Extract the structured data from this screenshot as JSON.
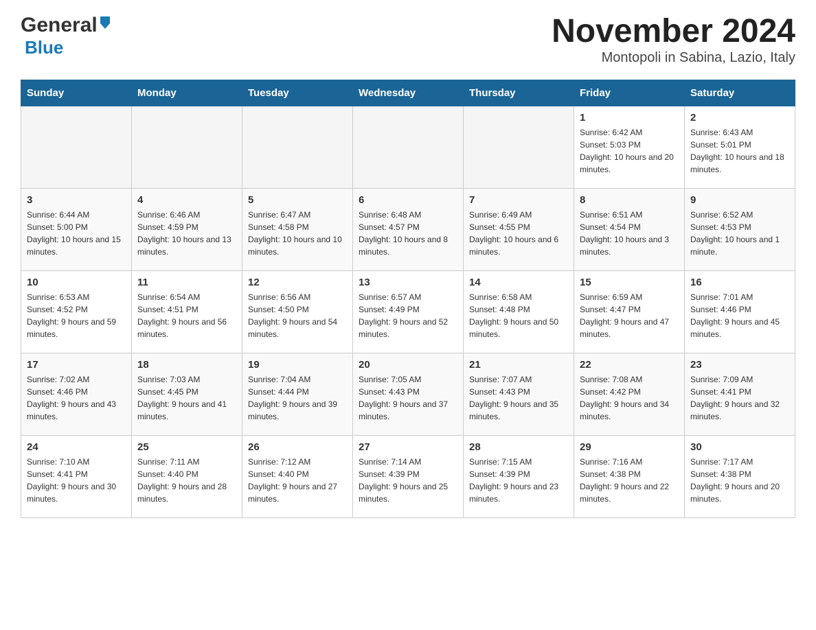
{
  "logo": {
    "general": "General",
    "blue": "Blue"
  },
  "title": "November 2024",
  "subtitle": "Montopoli in Sabina, Lazio, Italy",
  "weekdays": [
    "Sunday",
    "Monday",
    "Tuesday",
    "Wednesday",
    "Thursday",
    "Friday",
    "Saturday"
  ],
  "weeks": [
    [
      {
        "day": "",
        "sunrise": "",
        "sunset": "",
        "daylight": ""
      },
      {
        "day": "",
        "sunrise": "",
        "sunset": "",
        "daylight": ""
      },
      {
        "day": "",
        "sunrise": "",
        "sunset": "",
        "daylight": ""
      },
      {
        "day": "",
        "sunrise": "",
        "sunset": "",
        "daylight": ""
      },
      {
        "day": "",
        "sunrise": "",
        "sunset": "",
        "daylight": ""
      },
      {
        "day": "1",
        "sunrise": "Sunrise: 6:42 AM",
        "sunset": "Sunset: 5:03 PM",
        "daylight": "Daylight: 10 hours and 20 minutes."
      },
      {
        "day": "2",
        "sunrise": "Sunrise: 6:43 AM",
        "sunset": "Sunset: 5:01 PM",
        "daylight": "Daylight: 10 hours and 18 minutes."
      }
    ],
    [
      {
        "day": "3",
        "sunrise": "Sunrise: 6:44 AM",
        "sunset": "Sunset: 5:00 PM",
        "daylight": "Daylight: 10 hours and 15 minutes."
      },
      {
        "day": "4",
        "sunrise": "Sunrise: 6:46 AM",
        "sunset": "Sunset: 4:59 PM",
        "daylight": "Daylight: 10 hours and 13 minutes."
      },
      {
        "day": "5",
        "sunrise": "Sunrise: 6:47 AM",
        "sunset": "Sunset: 4:58 PM",
        "daylight": "Daylight: 10 hours and 10 minutes."
      },
      {
        "day": "6",
        "sunrise": "Sunrise: 6:48 AM",
        "sunset": "Sunset: 4:57 PM",
        "daylight": "Daylight: 10 hours and 8 minutes."
      },
      {
        "day": "7",
        "sunrise": "Sunrise: 6:49 AM",
        "sunset": "Sunset: 4:55 PM",
        "daylight": "Daylight: 10 hours and 6 minutes."
      },
      {
        "day": "8",
        "sunrise": "Sunrise: 6:51 AM",
        "sunset": "Sunset: 4:54 PM",
        "daylight": "Daylight: 10 hours and 3 minutes."
      },
      {
        "day": "9",
        "sunrise": "Sunrise: 6:52 AM",
        "sunset": "Sunset: 4:53 PM",
        "daylight": "Daylight: 10 hours and 1 minute."
      }
    ],
    [
      {
        "day": "10",
        "sunrise": "Sunrise: 6:53 AM",
        "sunset": "Sunset: 4:52 PM",
        "daylight": "Daylight: 9 hours and 59 minutes."
      },
      {
        "day": "11",
        "sunrise": "Sunrise: 6:54 AM",
        "sunset": "Sunset: 4:51 PM",
        "daylight": "Daylight: 9 hours and 56 minutes."
      },
      {
        "day": "12",
        "sunrise": "Sunrise: 6:56 AM",
        "sunset": "Sunset: 4:50 PM",
        "daylight": "Daylight: 9 hours and 54 minutes."
      },
      {
        "day": "13",
        "sunrise": "Sunrise: 6:57 AM",
        "sunset": "Sunset: 4:49 PM",
        "daylight": "Daylight: 9 hours and 52 minutes."
      },
      {
        "day": "14",
        "sunrise": "Sunrise: 6:58 AM",
        "sunset": "Sunset: 4:48 PM",
        "daylight": "Daylight: 9 hours and 50 minutes."
      },
      {
        "day": "15",
        "sunrise": "Sunrise: 6:59 AM",
        "sunset": "Sunset: 4:47 PM",
        "daylight": "Daylight: 9 hours and 47 minutes."
      },
      {
        "day": "16",
        "sunrise": "Sunrise: 7:01 AM",
        "sunset": "Sunset: 4:46 PM",
        "daylight": "Daylight: 9 hours and 45 minutes."
      }
    ],
    [
      {
        "day": "17",
        "sunrise": "Sunrise: 7:02 AM",
        "sunset": "Sunset: 4:46 PM",
        "daylight": "Daylight: 9 hours and 43 minutes."
      },
      {
        "day": "18",
        "sunrise": "Sunrise: 7:03 AM",
        "sunset": "Sunset: 4:45 PM",
        "daylight": "Daylight: 9 hours and 41 minutes."
      },
      {
        "day": "19",
        "sunrise": "Sunrise: 7:04 AM",
        "sunset": "Sunset: 4:44 PM",
        "daylight": "Daylight: 9 hours and 39 minutes."
      },
      {
        "day": "20",
        "sunrise": "Sunrise: 7:05 AM",
        "sunset": "Sunset: 4:43 PM",
        "daylight": "Daylight: 9 hours and 37 minutes."
      },
      {
        "day": "21",
        "sunrise": "Sunrise: 7:07 AM",
        "sunset": "Sunset: 4:43 PM",
        "daylight": "Daylight: 9 hours and 35 minutes."
      },
      {
        "day": "22",
        "sunrise": "Sunrise: 7:08 AM",
        "sunset": "Sunset: 4:42 PM",
        "daylight": "Daylight: 9 hours and 34 minutes."
      },
      {
        "day": "23",
        "sunrise": "Sunrise: 7:09 AM",
        "sunset": "Sunset: 4:41 PM",
        "daylight": "Daylight: 9 hours and 32 minutes."
      }
    ],
    [
      {
        "day": "24",
        "sunrise": "Sunrise: 7:10 AM",
        "sunset": "Sunset: 4:41 PM",
        "daylight": "Daylight: 9 hours and 30 minutes."
      },
      {
        "day": "25",
        "sunrise": "Sunrise: 7:11 AM",
        "sunset": "Sunset: 4:40 PM",
        "daylight": "Daylight: 9 hours and 28 minutes."
      },
      {
        "day": "26",
        "sunrise": "Sunrise: 7:12 AM",
        "sunset": "Sunset: 4:40 PM",
        "daylight": "Daylight: 9 hours and 27 minutes."
      },
      {
        "day": "27",
        "sunrise": "Sunrise: 7:14 AM",
        "sunset": "Sunset: 4:39 PM",
        "daylight": "Daylight: 9 hours and 25 minutes."
      },
      {
        "day": "28",
        "sunrise": "Sunrise: 7:15 AM",
        "sunset": "Sunset: 4:39 PM",
        "daylight": "Daylight: 9 hours and 23 minutes."
      },
      {
        "day": "29",
        "sunrise": "Sunrise: 7:16 AM",
        "sunset": "Sunset: 4:38 PM",
        "daylight": "Daylight: 9 hours and 22 minutes."
      },
      {
        "day": "30",
        "sunrise": "Sunrise: 7:17 AM",
        "sunset": "Sunset: 4:38 PM",
        "daylight": "Daylight: 9 hours and 20 minutes."
      }
    ]
  ]
}
